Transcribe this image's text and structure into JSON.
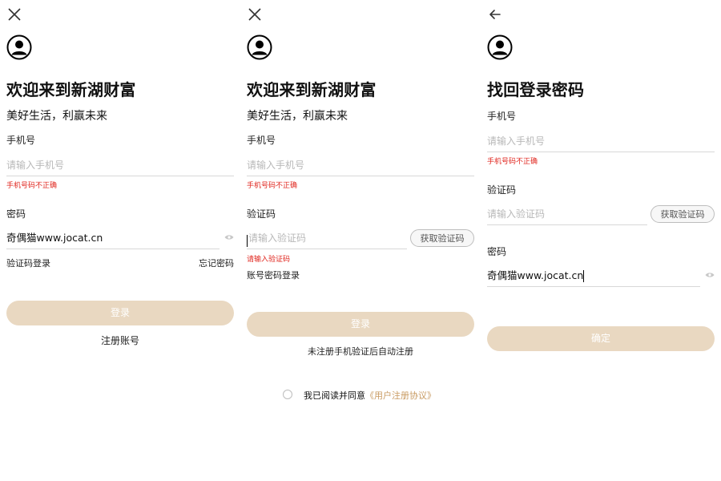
{
  "colors": {
    "accent": "#e9d8c1",
    "agreement_link": "#c99b62",
    "error": "#e0271f"
  },
  "panel_password_login": {
    "close_icon": "close-icon",
    "avatar_icon": "user-circle-icon",
    "title": "欢迎来到新湖财富",
    "subtitle": "美好生活，利赢未来",
    "phone_label": "手机号",
    "phone_placeholder": "请输入手机号",
    "phone_error": "手机号码不正确",
    "password_label": "密码",
    "password_value": "奇偶猫www.jocat.cn",
    "eye_icon": "eye-icon",
    "switch_link": "验证码登录",
    "forgot_link": "忘记密码",
    "login_button": "登录",
    "register_link": "注册账号"
  },
  "panel_code_login": {
    "close_icon": "close-icon",
    "avatar_icon": "user-circle-icon",
    "title": "欢迎来到新湖财富",
    "subtitle": "美好生活，利赢未来",
    "phone_label": "手机号",
    "phone_placeholder": "请输入手机号",
    "phone_error": "手机号码不正确",
    "code_label": "验证码",
    "code_placeholder": "请输入验证码",
    "get_code_button": "获取验证码",
    "code_error": "请输入验证码",
    "switch_link": "账号密码登录",
    "login_button": "登录",
    "auto_register_note": "未注册手机验证后自动注册",
    "agreement_text": "我已阅读并同意",
    "agreement_link": "《用户注册协议》"
  },
  "panel_reset_password": {
    "back_icon": "arrow-left-icon",
    "avatar_icon": "user-circle-icon",
    "title": "找回登录密码",
    "phone_label": "手机号",
    "phone_placeholder": "请输入手机号",
    "phone_error": "手机号码不正确",
    "code_label": "验证码",
    "code_placeholder": "请输入验证码",
    "get_code_button": "获取验证码",
    "password_label": "密码",
    "password_value": "奇偶猫www.jocat.cn",
    "eye_icon": "eye-icon",
    "confirm_button": "确定"
  }
}
